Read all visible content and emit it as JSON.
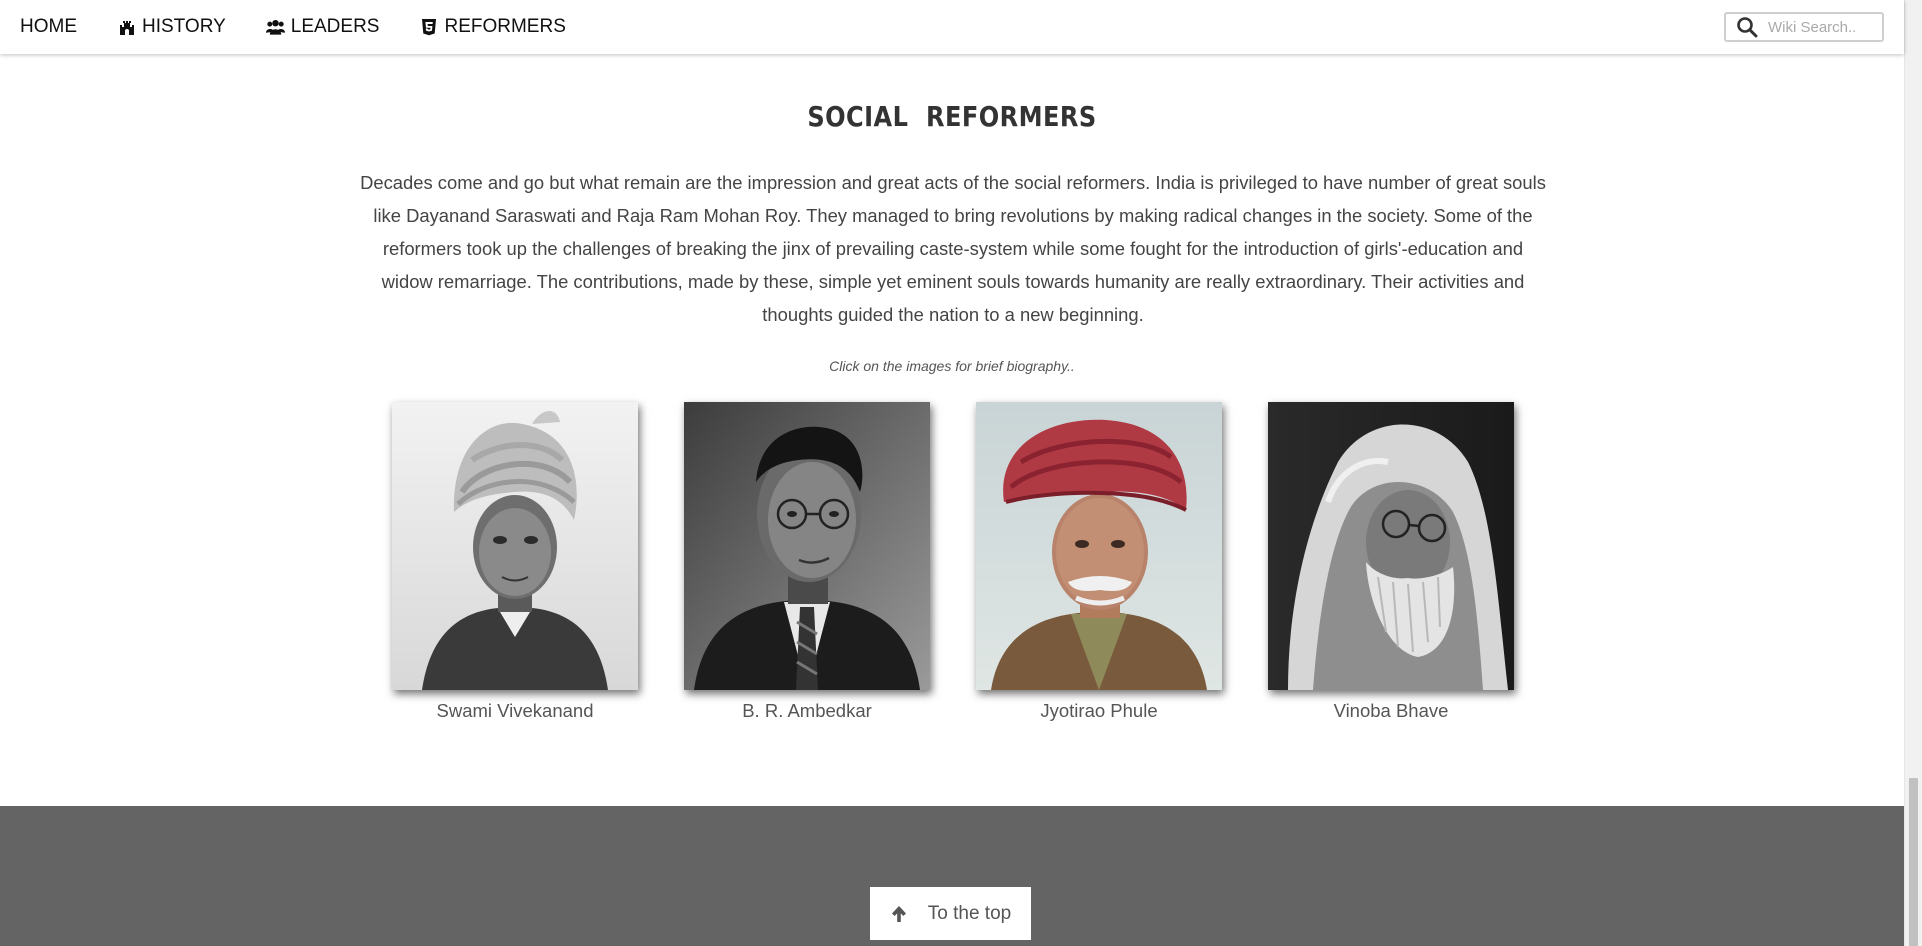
{
  "nav": {
    "items": [
      {
        "label": "HOME",
        "icon": ""
      },
      {
        "label": "HISTORY",
        "icon": "castle-icon"
      },
      {
        "label": "LEADERS",
        "icon": "users-icon"
      },
      {
        "label": "REFORMERS",
        "icon": "html5-icon"
      }
    ],
    "search": {
      "placeholder": "Wiki Search..",
      "icon": "search-icon"
    }
  },
  "main": {
    "title": "SOCIAL  REFORMERS",
    "intro": "Decades come and go but what remain are the impression and great acts of the social reformers. India is privileged to have number of great souls like Dayanand Saraswati and Raja Ram Mohan Roy. They managed to bring revolutions by making radical changes in the society. Some of the reformers took up the challenges of breaking the jinx of prevailing caste-system while some fought for the introduction of girls'-education and widow remarriage. The contributions, made by these, simple yet eminent souls towards humanity are really extraordinary. Their activities and thoughts guided the nation to a new beginning.",
    "hint": "Click on the images for brief biography..",
    "reformers": [
      {
        "name": "Swami Vivekanand"
      },
      {
        "name": "B. R. Ambedkar"
      },
      {
        "name": "Jyotirao Phule"
      },
      {
        "name": "Vinoba Bhave"
      }
    ]
  },
  "footer": {
    "top_button_label": "To the top",
    "top_button_icon": "arrow-up-icon",
    "background": "#646464"
  }
}
